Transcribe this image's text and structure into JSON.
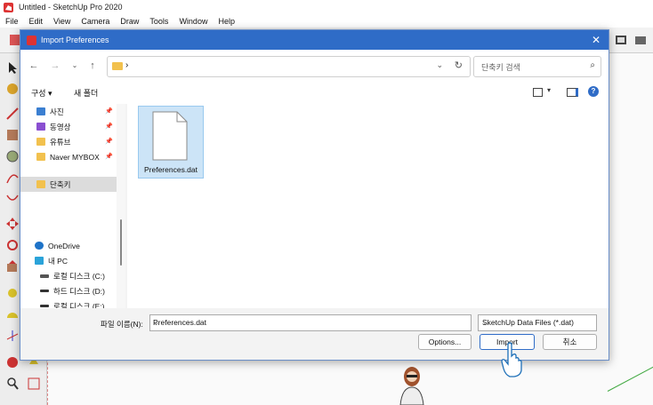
{
  "app": {
    "title": "Untitled - SketchUp Pro 2020",
    "menu": [
      "File",
      "Edit",
      "View",
      "Camera",
      "Draw",
      "Tools",
      "Window",
      "Help"
    ]
  },
  "dialog": {
    "title": "Import Preferences",
    "address_value": "›",
    "search_placeholder": "단축키 검색",
    "organize_label": "구성 ▾",
    "new_folder_label": "새 폴더",
    "nav_items": [
      {
        "label": "사진",
        "icon": "photos-icon",
        "pinned": true
      },
      {
        "label": "동영상",
        "icon": "videos-icon",
        "pinned": true
      },
      {
        "label": "유튜브",
        "icon": "folder-icon",
        "pinned": true
      },
      {
        "label": "Naver MYBOX",
        "icon": "folder-icon",
        "pinned": true
      },
      {
        "label": "단축키",
        "icon": "folder-icon",
        "selected": true
      },
      {
        "label": "OneDrive",
        "icon": "onedrive-icon"
      },
      {
        "label": "내 PC",
        "icon": "pc-icon"
      },
      {
        "label": "로컬 디스크 (C:)",
        "icon": "drive-icon"
      },
      {
        "label": "하드 디스크 (D:)",
        "icon": "drive-icon"
      },
      {
        "label": "로컬 디스크 (E:)",
        "icon": "drive-icon"
      }
    ],
    "file": {
      "name": "Preferences.dat"
    },
    "filename_label": "파일 이름(N):",
    "filename_value": "Preferences.dat",
    "filter_value": "SketchUp Data Files (*.dat)",
    "options_label": "Options...",
    "import_label": "Import",
    "cancel_label": "취소",
    "colors": {
      "titlebar": "#2f6cc7",
      "selection": "#cce4f7",
      "folder": "#f2c14e"
    }
  }
}
